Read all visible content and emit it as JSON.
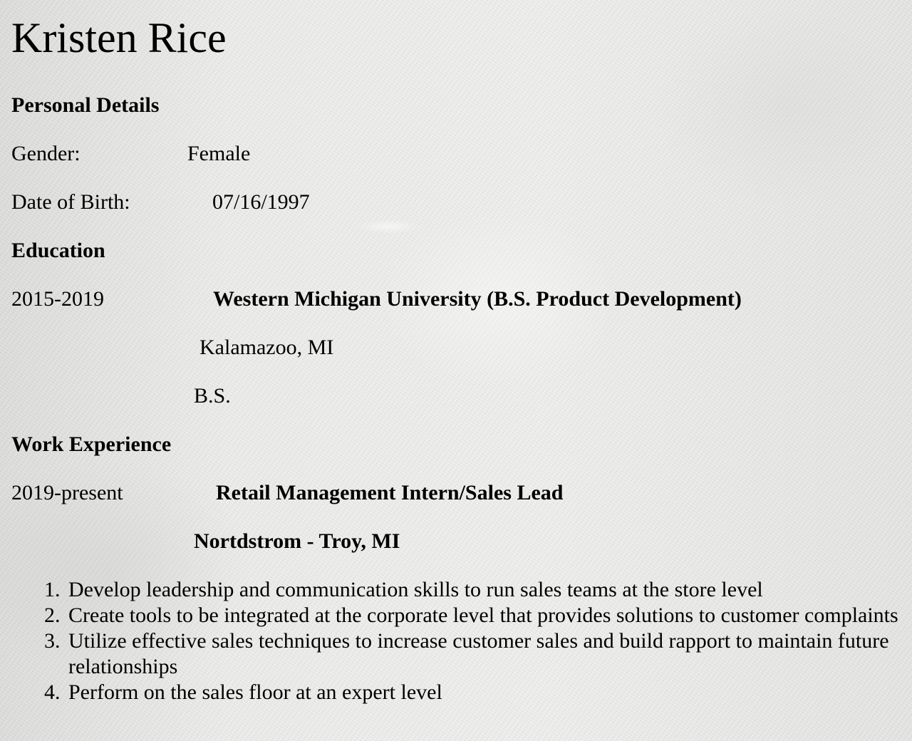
{
  "name": "Kristen Rice",
  "personal": {
    "heading": "Personal Details",
    "gender_label": "Gender:",
    "gender_value": "Female",
    "dob_label": "Date of Birth:",
    "dob_value": "07/16/1997"
  },
  "education": {
    "heading": "Education",
    "years": "2015-2019",
    "school": "Western Michigan University (B.S. Product Development)",
    "location": "Kalamazoo, MI",
    "degree": "B.S."
  },
  "work": {
    "heading": "Work Experience",
    "years": "2019-present",
    "title": "Retail Management Intern/Sales Lead",
    "company": "Nortdstrom - Troy, MI",
    "responsibilities": [
      {
        "num": "1.",
        "text": "Develop leadership and communication skills to run sales teams at the store level"
      },
      {
        "num": "2.",
        "text": "Create tools to be integrated at the corporate level that provides solutions to customer complaints"
      },
      {
        "num": "3.",
        "text": "Utilize effective sales techniques to increase customer sales and build rapport to maintain future relationships"
      },
      {
        "num": "4.",
        "text": "Perform on the sales floor at an expert level"
      }
    ]
  }
}
